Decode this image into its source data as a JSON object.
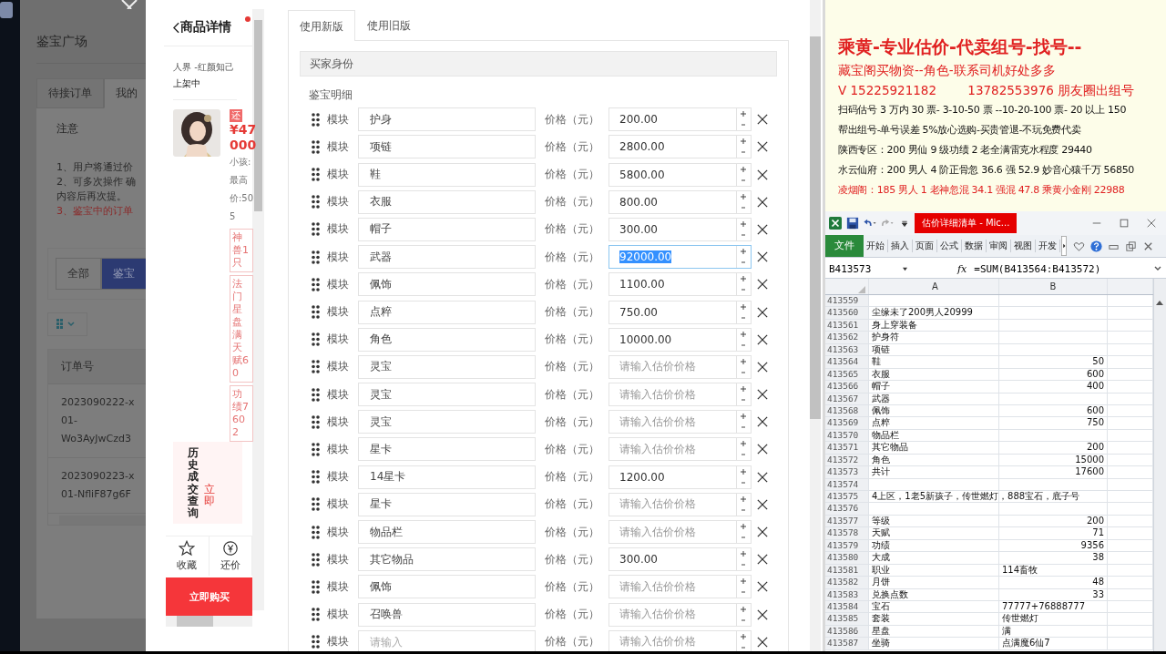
{
  "background_page": {
    "title": "鉴宝广场",
    "tabs": [
      {
        "label": "待接订单",
        "selected": false
      },
      {
        "label": "我的",
        "selected": true
      }
    ],
    "notice_title": "注意",
    "notice_lines": [
      {
        "text": "1、用户将通过价",
        "kind": "normal"
      },
      {
        "text": "2、可多次操作 确",
        "kind": "normal"
      },
      {
        "text": "内容后再次提。",
        "kind": "normal"
      },
      {
        "text": "3、鉴宝中的订单",
        "kind": "warning"
      }
    ],
    "filters": [
      {
        "label": "全部",
        "selected": false
      },
      {
        "label": "鉴宝",
        "selected": true
      }
    ],
    "table": {
      "columns": [
        "订单号"
      ],
      "rows": [
        {
          "lines": [
            "2023090222-x",
            "01-",
            "Wo3AyJwCzd3"
          ]
        },
        {
          "lines": [
            "2023090223-x",
            "01-NfliF87g6F"
          ]
        }
      ]
    }
  },
  "product": {
    "title": "商品详情",
    "server": "人界 -红颜知己",
    "status": "上架中",
    "badge": "还",
    "price": "¥47000",
    "summary_lines": [
      "小孩:",
      "最高",
      "价:50",
      "5"
    ],
    "tags": [
      "神兽1只",
      "法门星盘满天赋60",
      "功绩7602"
    ],
    "history": {
      "title": "历史成交查询",
      "action": "立即"
    },
    "actions": [
      {
        "label": "收藏",
        "kind": "star"
      },
      {
        "label": "还价",
        "kind": "yuan"
      }
    ],
    "buy_button": "立即购买"
  },
  "form": {
    "tabs": [
      {
        "label": "使用新版",
        "selected": true
      },
      {
        "label": "使用旧版",
        "selected": false
      }
    ],
    "section_title": "买家身份",
    "detail_title": "鉴宝明细",
    "rows": [
      {
        "module_label": "模块",
        "name": "护身",
        "price_label": "价格（元）",
        "price": "200.00",
        "focused": false
      },
      {
        "module_label": "模块",
        "name": "项链",
        "price_label": "价格（元）",
        "price": "2800.00",
        "focused": false
      },
      {
        "module_label": "模块",
        "name": "鞋",
        "price_label": "价格（元）",
        "price": "5800.00",
        "focused": false
      },
      {
        "module_label": "模块",
        "name": "衣服",
        "price_label": "价格（元）",
        "price": "800.00",
        "focused": false
      },
      {
        "module_label": "模块",
        "name": "帽子",
        "price_label": "价格（元）",
        "price": "300.00",
        "focused": false
      },
      {
        "module_label": "模块",
        "name": "武器",
        "price_label": "价格（元）",
        "price": "92000.00",
        "focused": true
      },
      {
        "module_label": "模块",
        "name": "佩饰",
        "price_label": "价格（元）",
        "price": "1100.00",
        "focused": false
      },
      {
        "module_label": "模块",
        "name": "点粹",
        "price_label": "价格（元）",
        "price": "750.00",
        "focused": false
      },
      {
        "module_label": "模块",
        "name": "角色",
        "price_label": "价格（元）",
        "price": "10000.00",
        "focused": false
      },
      {
        "module_label": "模块",
        "name": "灵宝",
        "price_label": "价格（元）",
        "price_placeholder": "请输入估价价格",
        "focused": false
      },
      {
        "module_label": "模块",
        "name": "灵宝",
        "price_label": "价格（元）",
        "price_placeholder": "请输入估价价格",
        "focused": false
      },
      {
        "module_label": "模块",
        "name": "灵宝",
        "price_label": "价格（元）",
        "price_placeholder": "请输入估价价格",
        "focused": false
      },
      {
        "module_label": "模块",
        "name": "星卡",
        "price_label": "价格（元）",
        "price_placeholder": "请输入估价价格",
        "focused": false
      },
      {
        "module_label": "模块",
        "name": "14星卡",
        "price_label": "价格（元）",
        "price": "1200.00",
        "focused": false
      },
      {
        "module_label": "模块",
        "name": "星卡",
        "price_label": "价格（元）",
        "price_placeholder": "请输入估价价格",
        "focused": false
      },
      {
        "module_label": "模块",
        "name": "物品栏",
        "price_label": "价格（元）",
        "price_placeholder": "请输入估价价格",
        "focused": false
      },
      {
        "module_label": "模块",
        "name": "其它物品",
        "price_label": "价格（元）",
        "price": "300.00",
        "focused": false
      },
      {
        "module_label": "模块",
        "name": "佩饰",
        "price_label": "价格（元）",
        "price_placeholder": "请输入估价价格",
        "focused": false
      },
      {
        "module_label": "模块",
        "name": "召唤兽",
        "price_label": "价格（元）",
        "price_placeholder": "请输入估价价格",
        "focused": false
      },
      {
        "module_label": "模块",
        "name_placeholder": "请输入",
        "price_label": "价格（元）",
        "price_placeholder": "请输入估价价格",
        "focused": false
      }
    ]
  },
  "document": {
    "lines": [
      {
        "text": "乘黄-专业估价-代卖组号-找号--",
        "kind": "headline"
      },
      {
        "text": "藏宝阁买物资--角色-联系司机好处多多",
        "kind": "red"
      },
      {
        "text": "V 15225921182        13782553976 朋友圈出组号",
        "kind": "red"
      },
      {
        "text": "扫码估号 3 万内 30 票- 3-10-50 票  --10-20-100 票- 20 以上 150",
        "kind": "plain"
      },
      {
        "text": "帮出组号-单号误差 5%放心选购-买贵管退-不玩免费代卖",
        "kind": "plain"
      },
      {
        "text": "陕西专区：200 男仙 9 级功绩 2 老全满雷克水程度 29440",
        "kind": "plain"
      },
      {
        "text": "水云仙府：200 男人 4 阶正骨忽 36.6 强 52.9 妙音心猿千万 56850",
        "kind": "plain"
      },
      {
        "text": "凌烟阁：185 男人 1 老神忽混 34.1 强混 47.8 乘黄小金刚 22988",
        "kind": "red_small"
      }
    ]
  },
  "spreadsheet": {
    "title": "估价详细清单 - Mic...",
    "file_tab": "文件",
    "ribbon_tabs": [
      "开始",
      "插入",
      "页面",
      "公式",
      "数据",
      "审阅",
      "视图",
      "开发"
    ],
    "name_box": "B413573",
    "function_label": "fx",
    "formula": "=SUM(B413564:B413572)",
    "columns": [
      "A",
      "B"
    ],
    "rows": [
      {
        "number": "413559"
      },
      {
        "number": "413560",
        "a": "尘缘未了200男人20999"
      },
      {
        "number": "413561",
        "a": "身上穿装备"
      },
      {
        "number": "413562",
        "a": "护身符"
      },
      {
        "number": "413563",
        "a": "项链"
      },
      {
        "number": "413564",
        "a": "鞋",
        "b": "50",
        "b_numeric": true
      },
      {
        "number": "413565",
        "a": "衣服",
        "b": "600",
        "b_numeric": true
      },
      {
        "number": "413566",
        "a": "帽子",
        "b": "400",
        "b_numeric": true
      },
      {
        "number": "413567",
        "a": "武器"
      },
      {
        "number": "413568",
        "a": "佩饰",
        "b": "600",
        "b_numeric": true
      },
      {
        "number": "413569",
        "a": "点粹",
        "b": "750",
        "b_numeric": true
      },
      {
        "number": "413570",
        "a": "物品栏"
      },
      {
        "number": "413571",
        "a": "其它物品",
        "b": "200",
        "b_numeric": true
      },
      {
        "number": "413572",
        "a": "角色",
        "b": "15000",
        "b_numeric": true
      },
      {
        "number": "413573",
        "a": "共计",
        "b": "17600",
        "b_numeric": true
      },
      {
        "number": "413574"
      },
      {
        "number": "413575",
        "a": "4上区，1老5新孩子，传世燃灯，888宝石，底子号"
      },
      {
        "number": "413576"
      },
      {
        "number": "413577",
        "a": "等级",
        "b": "200",
        "b_numeric": true
      },
      {
        "number": "413578",
        "a": "天赋",
        "b": "71",
        "b_numeric": true
      },
      {
        "number": "413579",
        "a": "功绩",
        "b": "9356",
        "b_numeric": true
      },
      {
        "number": "413580",
        "a": "大成",
        "b": "38",
        "b_numeric": true
      },
      {
        "number": "413581",
        "a": "职业",
        "b": "114畜牧",
        "b_numeric": false
      },
      {
        "number": "413582",
        "a": "月饼",
        "b": "48",
        "b_numeric": true
      },
      {
        "number": "413583",
        "a": "兑换点数",
        "b": "33",
        "b_numeric": true
      },
      {
        "number": "413584",
        "a": "宝石",
        "b": "77777+76888777",
        "b_numeric": false
      },
      {
        "number": "413585",
        "a": "套装",
        "b": "传世燃灯",
        "b_numeric": false
      },
      {
        "number": "413586",
        "a": "星盘",
        "b": "满",
        "b_numeric": false
      },
      {
        "number": "413587",
        "a": "坐骑",
        "b": "点满魔6仙7",
        "b_numeric": false
      }
    ]
  }
}
